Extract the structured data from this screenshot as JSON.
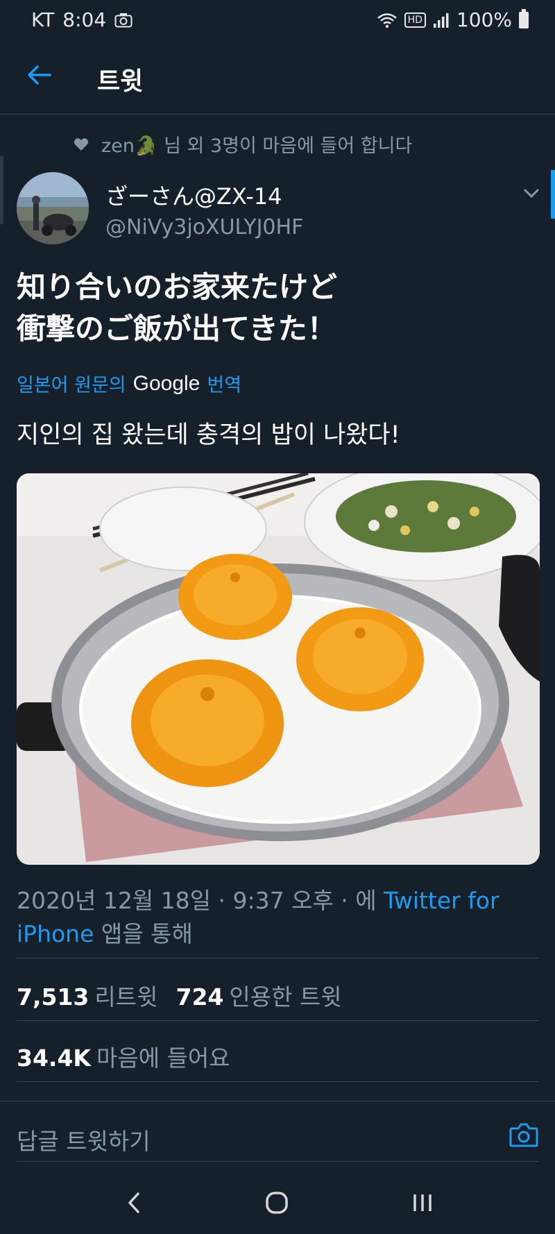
{
  "status_bar": {
    "carrier": "KT",
    "time": "8:04",
    "hd": "HD",
    "battery": "100%"
  },
  "app_bar": {
    "title": "트윗"
  },
  "social_context": {
    "name": "zen🐊",
    "text": "님 외 3명이 마음에 들어 합니다"
  },
  "author": {
    "display_name": "ざーさん@ZX-14",
    "handle": "@NiVy3joXULYJ0HF"
  },
  "tweet": {
    "line1": "知り合いのお家来たけど",
    "line2": "衝撃のご飯が出てきた！"
  },
  "translation": {
    "label": "일본어 원문의",
    "google": "Google",
    "action": "번역",
    "text": "지인의 집 왔는데 충격의 밥이 나왔다!"
  },
  "meta": {
    "timestamp": "2020년 12월 18일 · 9:37 오후 · 에",
    "source": "Twitter for iPhone",
    "suffix": "앱을 통해"
  },
  "stats": {
    "retweets": "7,513",
    "retweets_label": "리트윗",
    "quotes": "724",
    "quotes_label": "인용한 트윗",
    "likes": "34.4K",
    "likes_label": "마음에 들어요"
  },
  "reply": {
    "placeholder": "답글 트윗하기"
  },
  "colors": {
    "background": "#15202b",
    "accent": "#1d9bf0",
    "secondary_text": "#8899a6",
    "divider": "#38444d"
  }
}
